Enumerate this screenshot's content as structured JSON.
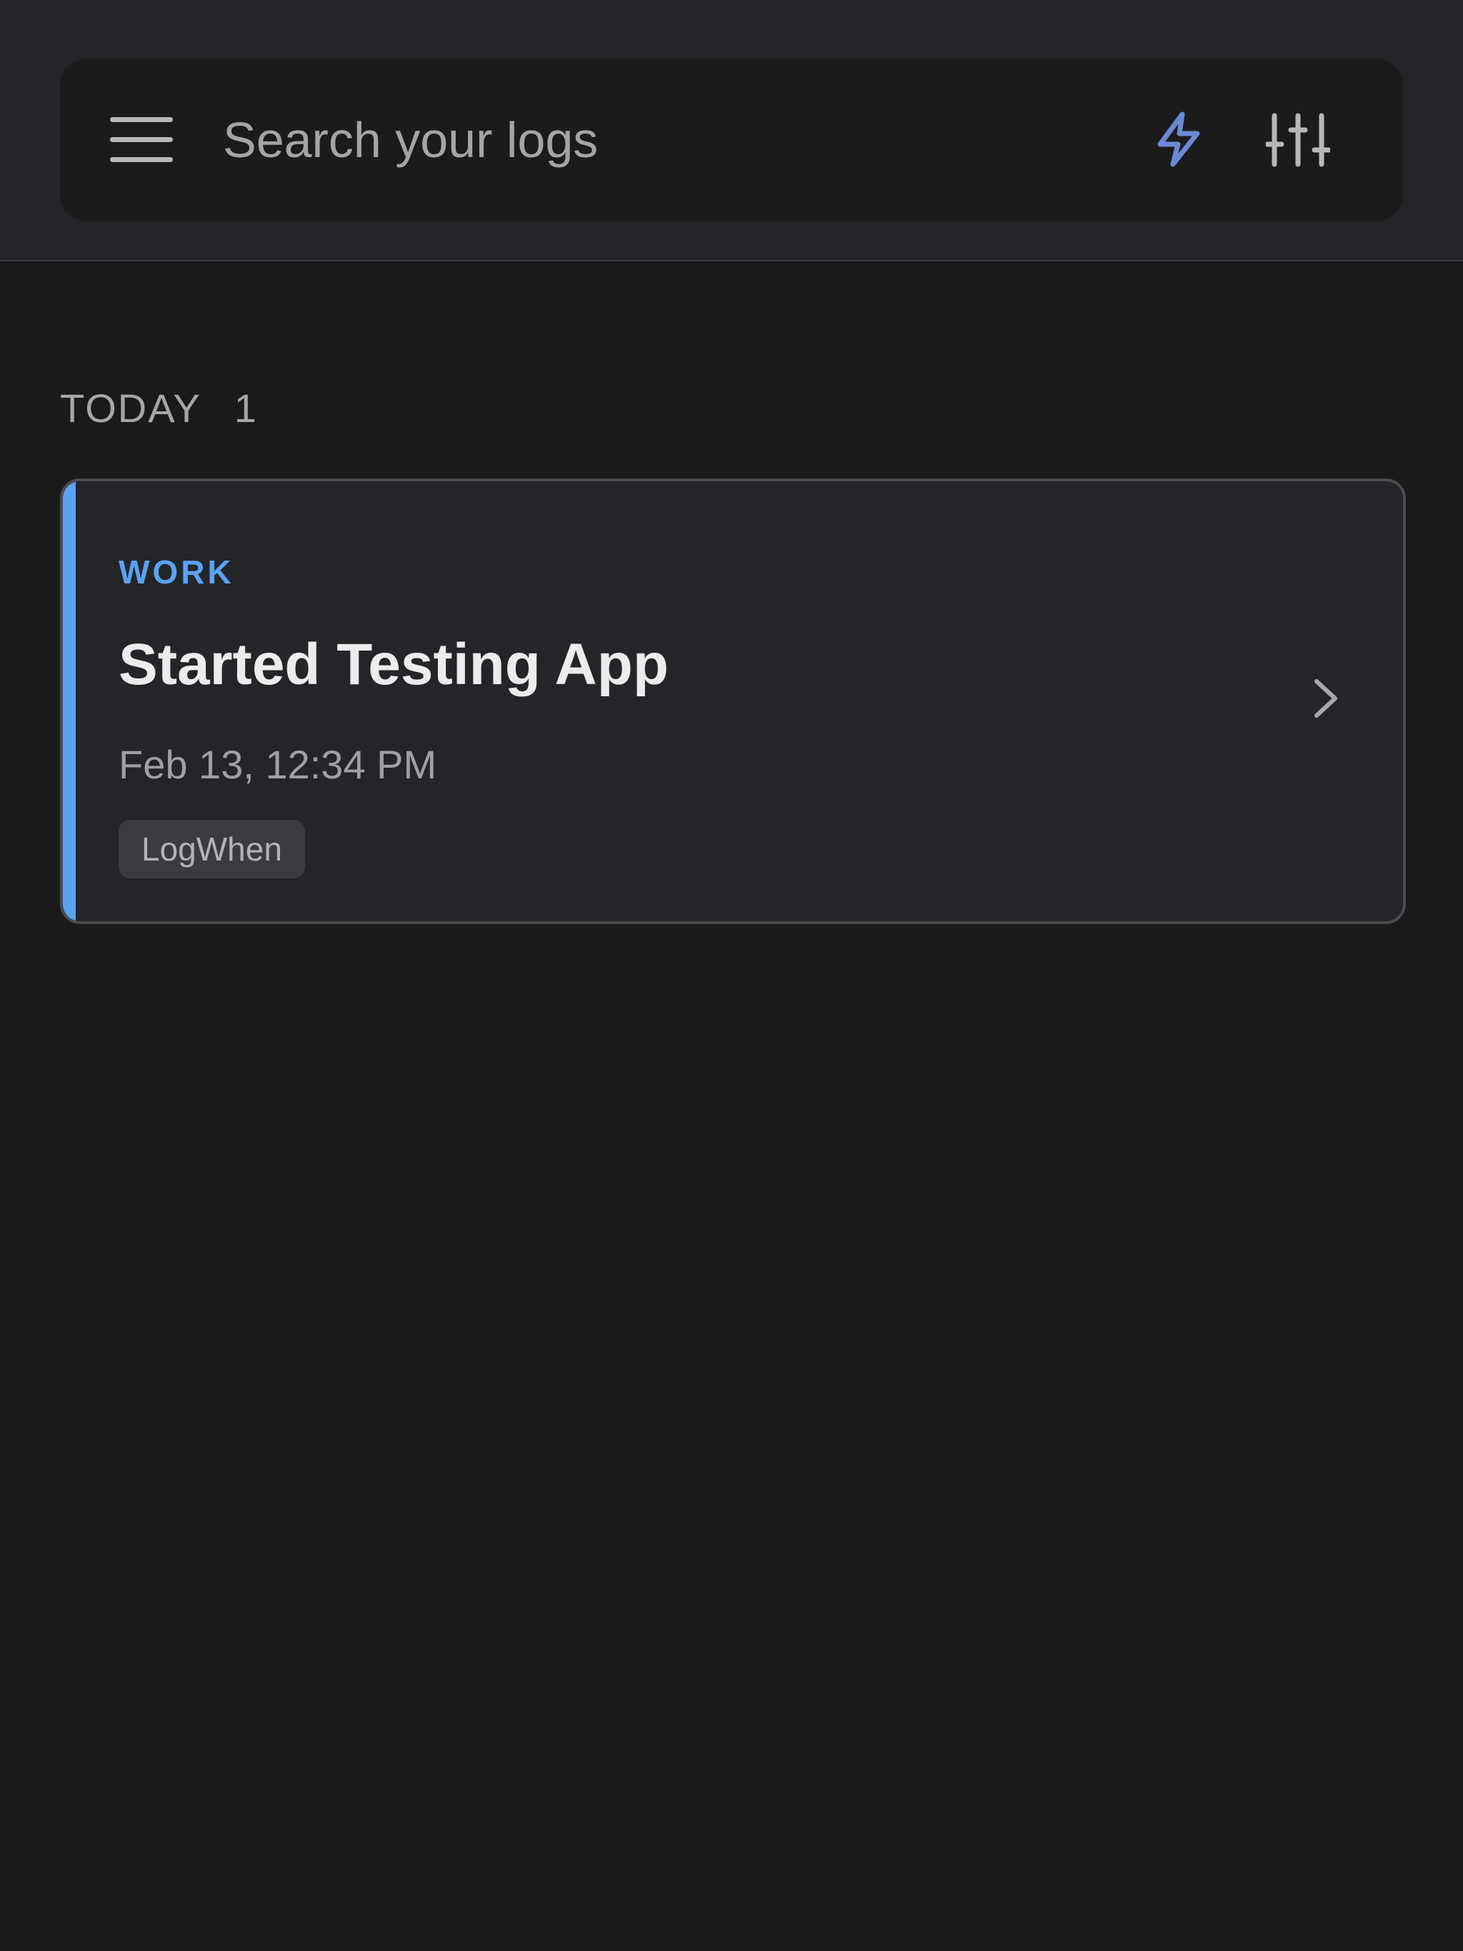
{
  "search": {
    "placeholder": "Search your logs",
    "value": ""
  },
  "toolbar": {
    "menu_icon": "hamburger-menu-icon",
    "quick_log_icon": "lightning-bolt-icon",
    "filters_icon": "sliders-icon"
  },
  "section": {
    "label": "TODAY",
    "count": "1"
  },
  "logs": [
    {
      "category": "WORK",
      "title": "Started Testing App",
      "timestamp": "Feb 13, 12:34 PM",
      "tag": "LogWhen",
      "chevron_icon": "chevron-right-icon"
    }
  ],
  "colors": {
    "accent_blue": "#5aa2f3",
    "bolt_blue": "#6b89d6",
    "icon_gray": "#b8b8bb",
    "background": "#1a1a1a",
    "topbar": "#232427",
    "card": "#242528"
  }
}
